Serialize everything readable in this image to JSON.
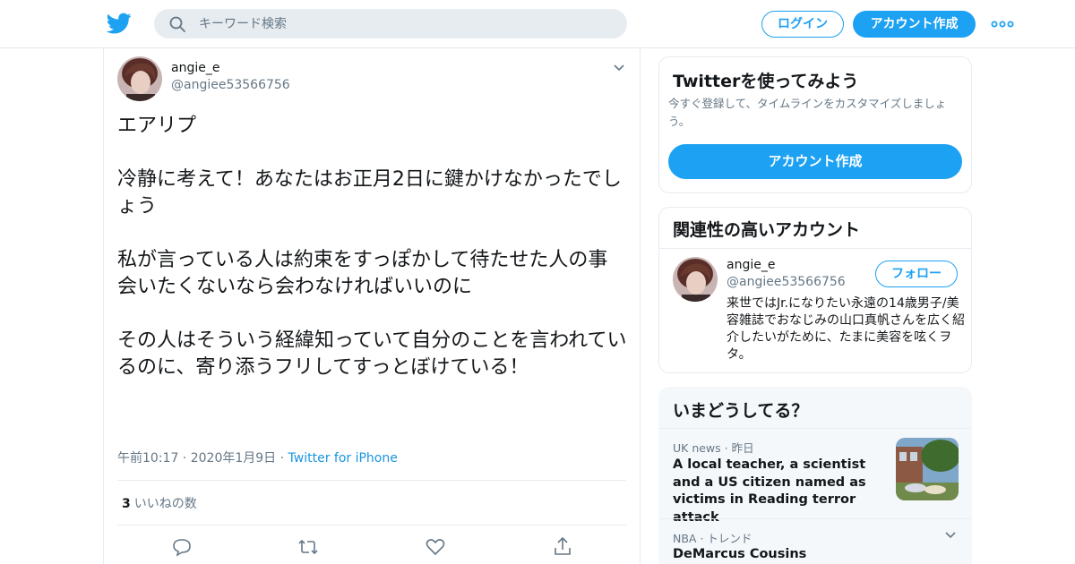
{
  "header": {
    "search_placeholder": "キーワード検索",
    "login_label": "ログイン",
    "signup_label": "アカウント作成",
    "brand_color": "#1da1f2"
  },
  "tweet": {
    "user_name": "angie_e",
    "user_handle": "@angiee53566756",
    "text": "エアリプ\n\n冷静に考えて！あなたはお正月2日に鍵かけなかったでしょう\n\n私が言っている人は約束をすっぽかして待たせた人の事\n会いたくないなら会わなければいいのに\n\nその人はそういう経緯知っていて自分のことを言われているのに、寄り添うフリしてすっとぼけている！",
    "time": "午前10:17",
    "date": "2020年1月9日",
    "source": "Twitter for iPhone",
    "likes_count": "3",
    "likes_label": "いいねの数"
  },
  "signup_card": {
    "title": "Twitterを使ってみよう",
    "subtitle": "今すぐ登録して、タイムラインをカスタマイズしましょう。",
    "button_label": "アカウント作成"
  },
  "related_card": {
    "title": "関連性の高いアカウント",
    "name": "angie_e",
    "handle": "@angiee53566756",
    "follow_label": "フォロー",
    "bio": "来世ではJr.になりたい永遠の14歳男子/美容雑誌でおなじみの山口真帆さんを広く紹介したいがために、たまに美容を呟くヲタ。"
  },
  "trends_card": {
    "title": "いまどうしてる？",
    "items": [
      {
        "source": "UK news",
        "when": "昨日",
        "title": "A local teacher, a scientist and a US citizen named as victims in Reading terror attack"
      },
      {
        "source": "NBA",
        "when": "トレンド",
        "title": "DeMarcus Cousins"
      }
    ]
  }
}
